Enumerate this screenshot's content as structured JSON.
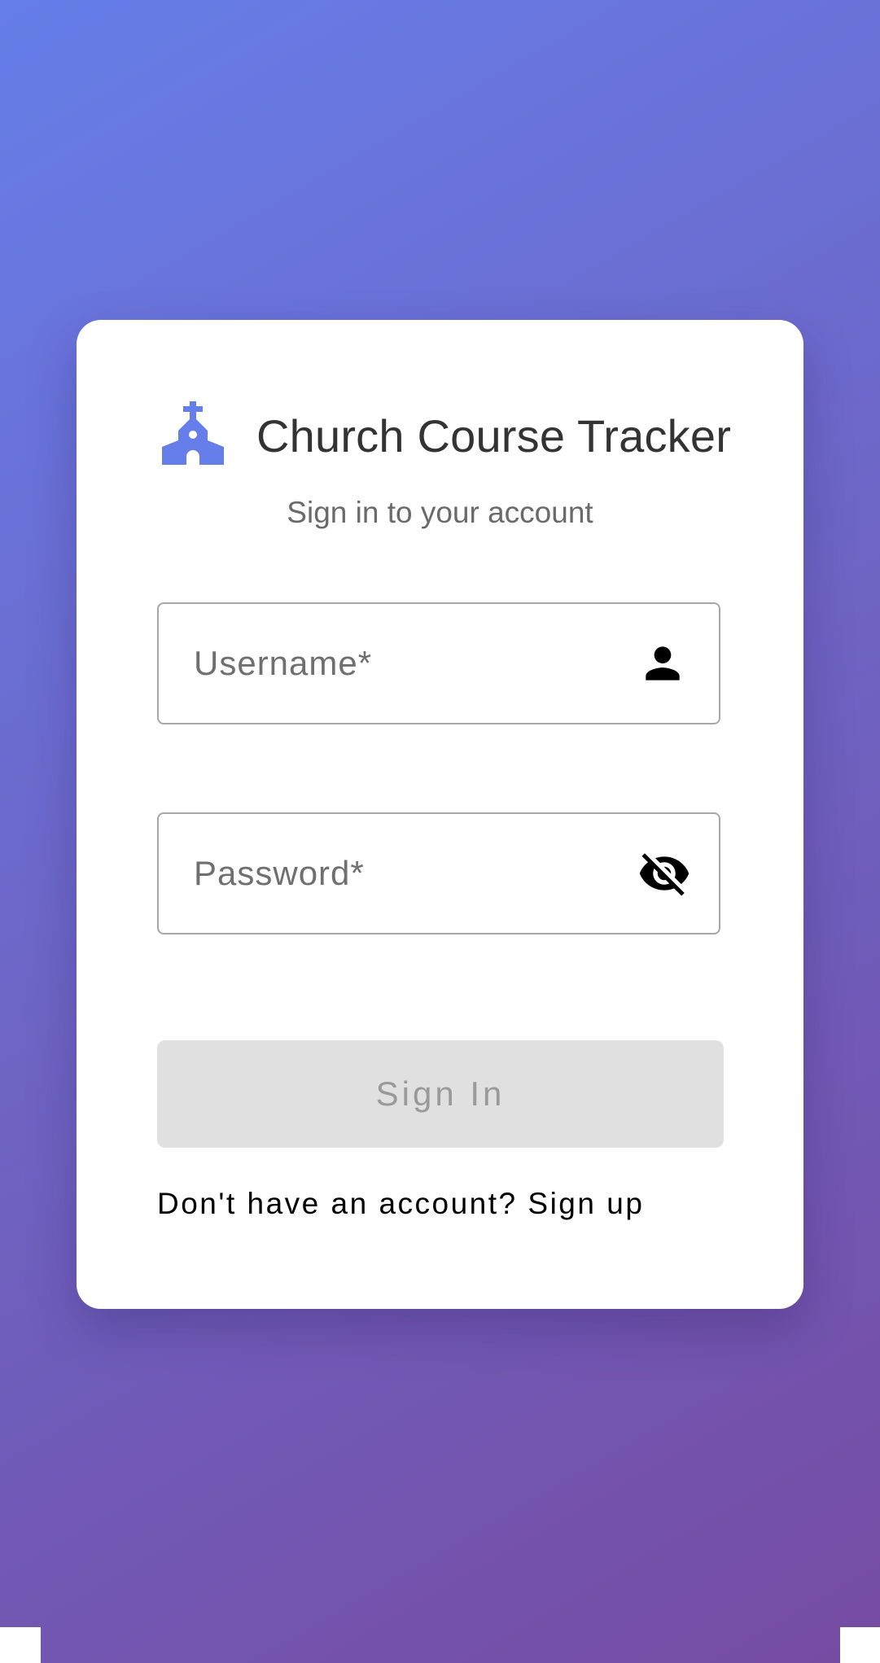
{
  "app": {
    "title": "Church Course Tracker",
    "subtitle": "Sign in to your account",
    "logo_icon": "church-icon"
  },
  "form": {
    "username": {
      "placeholder": "Username*",
      "value": "",
      "icon": "person-icon"
    },
    "password": {
      "placeholder": "Password*",
      "value": "",
      "icon": "eye-off-icon"
    },
    "submit_label": "Sign In",
    "submit_disabled": true
  },
  "footer": {
    "prompt": "Don't have an account?",
    "link_label": "Sign up"
  },
  "colors": {
    "gradient_start": "#667eea",
    "gradient_end": "#764ba2",
    "accent": "#667eea",
    "card_bg": "#ffffff",
    "button_disabled_bg": "#e0e0e0",
    "button_disabled_text": "#9a9a9a"
  }
}
